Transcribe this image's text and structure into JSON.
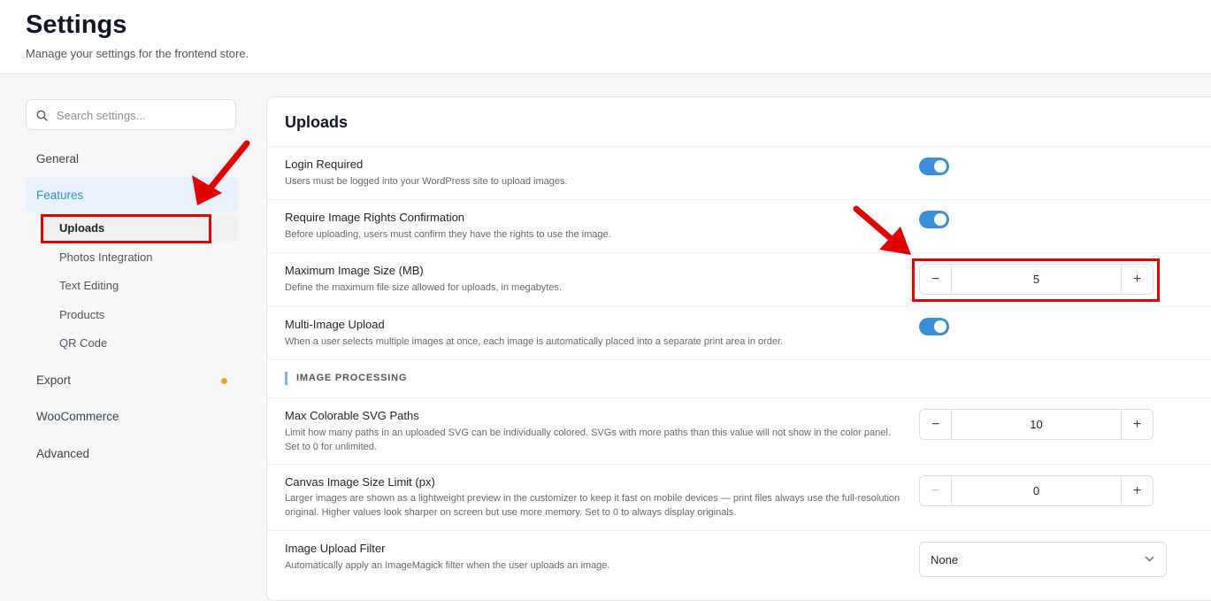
{
  "header": {
    "title": "Settings",
    "subtitle": "Manage your settings for the frontend store."
  },
  "sidebar": {
    "search_placeholder": "Search settings...",
    "items": [
      {
        "label": "General"
      },
      {
        "label": "Features",
        "active": true
      },
      {
        "label": "Export",
        "badge_color": "#f0a020"
      },
      {
        "label": "WooCommerce"
      },
      {
        "label": "Advanced"
      }
    ],
    "feature_subitems": [
      {
        "label": "Uploads",
        "active": true
      },
      {
        "label": "Photos Integration"
      },
      {
        "label": "Text Editing"
      },
      {
        "label": "Products"
      },
      {
        "label": "QR Code"
      }
    ]
  },
  "panel": {
    "title": "Uploads",
    "rows": [
      {
        "title": "Login Required",
        "desc": "Users must be logged into your WordPress site to upload images.",
        "control": "toggle",
        "on": true
      },
      {
        "title": "Require Image Rights Confirmation",
        "desc": "Before uploading, users must confirm they have the rights to use the image.",
        "control": "toggle",
        "on": true
      },
      {
        "title": "Maximum Image Size (MB)",
        "desc": "Define the maximum file size allowed for uploads, in megabytes.",
        "control": "stepper",
        "value": "5"
      },
      {
        "title": "Multi-Image Upload",
        "desc": "When a user selects multiple images at once, each image is automatically placed into a separate print area in order.",
        "control": "toggle",
        "on": true
      }
    ],
    "section_label": "IMAGE PROCESSING",
    "processing_rows": [
      {
        "title": "Max Colorable SVG Paths",
        "desc": "Limit how many paths in an uploaded SVG can be individually colored. SVGs with more paths than this value will not show in the color panel. Set to 0 for unlimited.",
        "control": "stepper",
        "value": "10"
      },
      {
        "title": "Canvas Image Size Limit (px)",
        "desc": "Larger images are shown as a lightweight preview in the customizer to keep it fast on mobile devices — print files always use the full-resolution original. Higher values look sharper on screen but use more memory. Set to 0 to always display originals.",
        "control": "stepper",
        "value": "0"
      },
      {
        "title": "Image Upload Filter",
        "desc": "Automatically apply an ImageMagick filter when the user uploads an image.",
        "control": "select",
        "value": "None"
      }
    ]
  },
  "stepper_symbols": {
    "minus": "−",
    "plus": "+"
  },
  "colors": {
    "accent": "#3b8fd9",
    "annotation": "#e00000"
  }
}
